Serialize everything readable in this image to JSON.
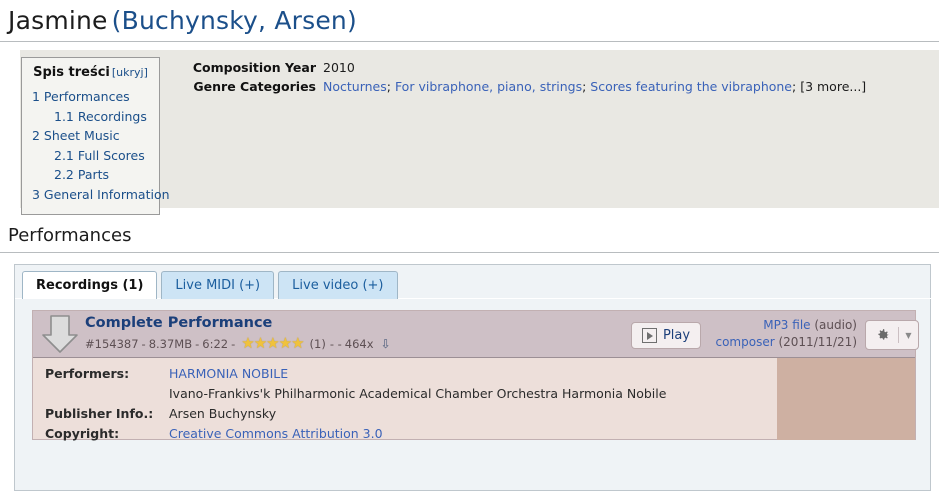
{
  "header": {
    "work_title": "Jasmine",
    "composer": "(Buchynsky, Arsen)"
  },
  "toc": {
    "title": "Spis treści",
    "hide_label": "[ukryj]",
    "items": [
      {
        "label": "1 Performances",
        "level": 1
      },
      {
        "label": "1.1 Recordings",
        "level": 2
      },
      {
        "label": "2 Sheet Music",
        "level": 1
      },
      {
        "label": "2.1 Full Scores",
        "level": 2
      },
      {
        "label": "2.2 Parts",
        "level": 2
      },
      {
        "label": "3 General Information",
        "level": 1
      }
    ]
  },
  "info": {
    "composition_year_label": "Composition Year",
    "composition_year_value": "2010",
    "genre_label": "Genre Categories",
    "genres": [
      "Nocturnes",
      "For vibraphone, piano, strings",
      "Scores featuring the vibraphone"
    ],
    "genre_more": "[3 more...]"
  },
  "section": {
    "performances_heading": "Performances"
  },
  "tabs": [
    {
      "label": "Recordings (1)",
      "active": true
    },
    {
      "label": "Live MIDI (+)",
      "active": false
    },
    {
      "label": "Live video (+)",
      "active": false
    }
  ],
  "recording": {
    "download_icon": "download-arrow-icon",
    "title": "Complete Performance",
    "meta_id": "#154387",
    "meta_size": "8.37MB",
    "meta_duration": "6:22",
    "star_rating": 5,
    "rating_count": "(1)",
    "meta_dash": "- -",
    "download_count": "464x",
    "download_glyph": "⇩",
    "play_label": "Play",
    "play_icon": "play-icon",
    "file_type": "MP3 file",
    "file_type_suffix": "(audio)",
    "uploader": "composer",
    "upload_date": "(2011/11/21)",
    "gear_icon": "gear-icon",
    "caret_icon": "chevron-down-icon",
    "details": [
      {
        "label": "Performers:",
        "value": "HARMONIA NOBILE",
        "style": "link"
      },
      {
        "label": "",
        "value": "Ivano-Frankivs'k Philharmonic Academical Chamber Orchestra Harmonia Nobile",
        "style": "plain"
      },
      {
        "label": "Publisher Info.:",
        "value": "Arsen Buchynsky",
        "style": "plain"
      },
      {
        "label": "Copyright:",
        "value": "Creative Commons Attribution 3.0",
        "style": "link"
      }
    ]
  },
  "colors": {
    "link": "#3a62b8",
    "title_link": "#1b4f8a",
    "card_header_bg": "#cec0c6",
    "card_body_bg": "#eddfda",
    "right_block_bg": "#ceb0a2",
    "info_panel_bg": "#e9e8e3",
    "tab_inactive_bg": "#cde4f5",
    "star": "#f0c23c"
  }
}
